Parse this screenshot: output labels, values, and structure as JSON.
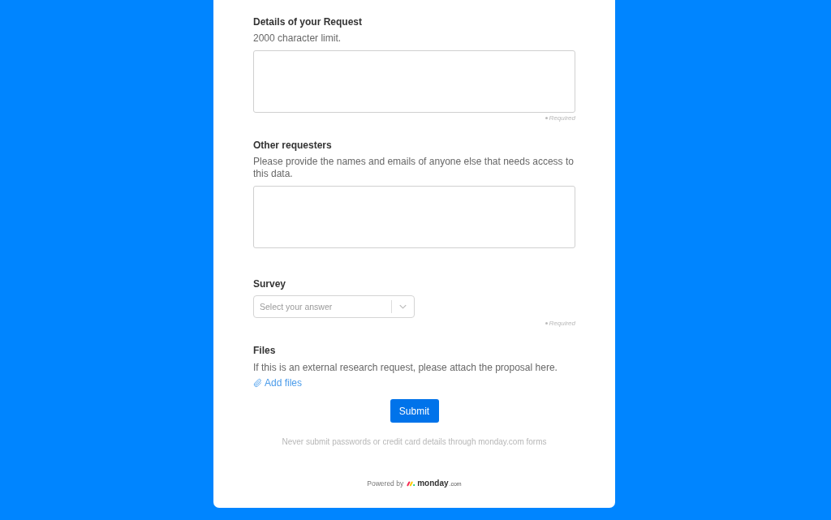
{
  "fields": [
    {
      "kind": "textarea",
      "label": "Details of your Request",
      "description": "2000 character limit.",
      "required": true,
      "required_text": "Required"
    },
    {
      "kind": "textarea",
      "label": "Other requesters",
      "description": "Please provide the names and emails of anyone else that needs access to this data.",
      "required": false
    },
    {
      "kind": "select",
      "label": "Survey",
      "placeholder": "Select your answer",
      "required": true,
      "required_text": "Required"
    },
    {
      "kind": "files",
      "label": "Files",
      "description": "If this is an external research request, please attach the proposal here.",
      "link": "Add files",
      "required": false
    }
  ],
  "submit": "Submit",
  "notice": "Never submit passwords or credit card details through monday.com forms",
  "footer": {
    "powered_by": "Powered by",
    "brand": "monday",
    "brand_suffix": ".com"
  }
}
